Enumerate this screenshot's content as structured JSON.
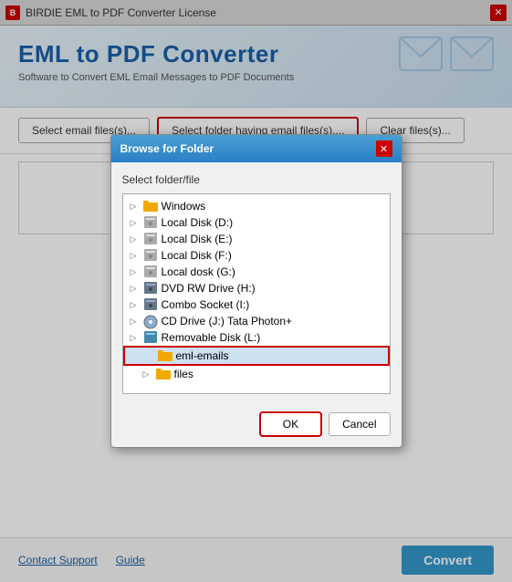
{
  "titleBar": {
    "title": "BIRDIE EML to PDF Converter License",
    "closeLabel": "✕"
  },
  "header": {
    "title": "EML to PDF Converter",
    "subtitle": "Software to Convert EML Email Messages to PDF Documents"
  },
  "toolbar": {
    "selectFilesLabel": "Select email files(s)...",
    "selectFolderLabel": "Select folder having email files(s)....",
    "clearFilesLabel": "Clear files(s)..."
  },
  "modal": {
    "title": "Browse for Folder",
    "label": "Select folder/file",
    "treeItems": [
      {
        "id": "windows",
        "indent": 1,
        "arrow": "▷",
        "iconType": "folder",
        "label": "Windows"
      },
      {
        "id": "localDiskD",
        "indent": 1,
        "arrow": "▷",
        "iconType": "disk-gray",
        "label": "Local Disk (D:)"
      },
      {
        "id": "localDiskE",
        "indent": 1,
        "arrow": "▷",
        "iconType": "disk-gray",
        "label": "Local Disk (E:)"
      },
      {
        "id": "localDiskF",
        "indent": 1,
        "arrow": "▷",
        "iconType": "disk-gray",
        "label": "Local Disk (F:)"
      },
      {
        "id": "localDiskG",
        "indent": 1,
        "arrow": "▷",
        "iconType": "disk-gray",
        "label": "Local dosk  (G:)"
      },
      {
        "id": "dvdDriveH",
        "indent": 1,
        "arrow": "▷",
        "iconType": "disk-dvd",
        "label": "DVD RW Drive (H:)"
      },
      {
        "id": "comboI",
        "indent": 1,
        "arrow": "▷",
        "iconType": "disk-dvd",
        "label": "Combo Socket (I:)"
      },
      {
        "id": "cdDriveJ",
        "indent": 1,
        "arrow": "▷",
        "iconType": "disk-cd",
        "label": "CD Drive (J:) Tata Photon+"
      },
      {
        "id": "removableL",
        "indent": 1,
        "arrow": "▷",
        "iconType": "disk-removable",
        "label": "Removable Disk (L:)"
      },
      {
        "id": "emlEmails",
        "indent": 2,
        "arrow": "",
        "iconType": "folder",
        "label": "eml-emails",
        "selected": true
      },
      {
        "id": "files",
        "indent": 2,
        "arrow": "▷",
        "iconType": "folder",
        "label": "files"
      }
    ],
    "okLabel": "OK",
    "cancelLabel": "Cancel"
  },
  "footer": {
    "contactSupportLabel": "Contact Support",
    "guideLabel": "Guide",
    "convertLabel": "Convert"
  }
}
